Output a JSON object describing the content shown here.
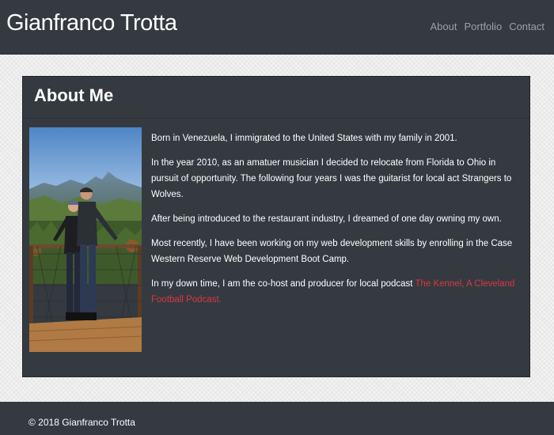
{
  "navbar": {
    "brand": "Gianfranco Trotta",
    "links": [
      {
        "label": "About"
      },
      {
        "label": "Portfolio"
      },
      {
        "label": "Contact"
      }
    ]
  },
  "about": {
    "title": "About Me",
    "photo_icon": "profile-photo",
    "paragraphs": [
      "Born in Venezuela, I immigrated to the United States with my family in 2001.",
      "In the year 2010, as an amatuer musician I decided to relocate from Florida to Ohio in pursuit of opportunity. The following four years I was the guitarist for local act Strangers to Wolves.",
      "After being introduced to the restaurant industry, I dreamed of one day owning my own.",
      "Most recently, I have been working on my web development skills by enrolling in the Case Western Reserve Web Development Boot Camp."
    ],
    "last_paragraph_text": "In my down time, I am the co-host and producer for local podcast ",
    "podcast_link": "The Kennel, A Cleveland Football Podcast."
  },
  "footer": {
    "text": "© 2018 Gianfranco Trotta"
  },
  "colors": {
    "navbar_bg": "#343a40",
    "page_bg": "#ececec",
    "link_accent": "#dc3545",
    "nav_link": "#9aa0a6"
  }
}
